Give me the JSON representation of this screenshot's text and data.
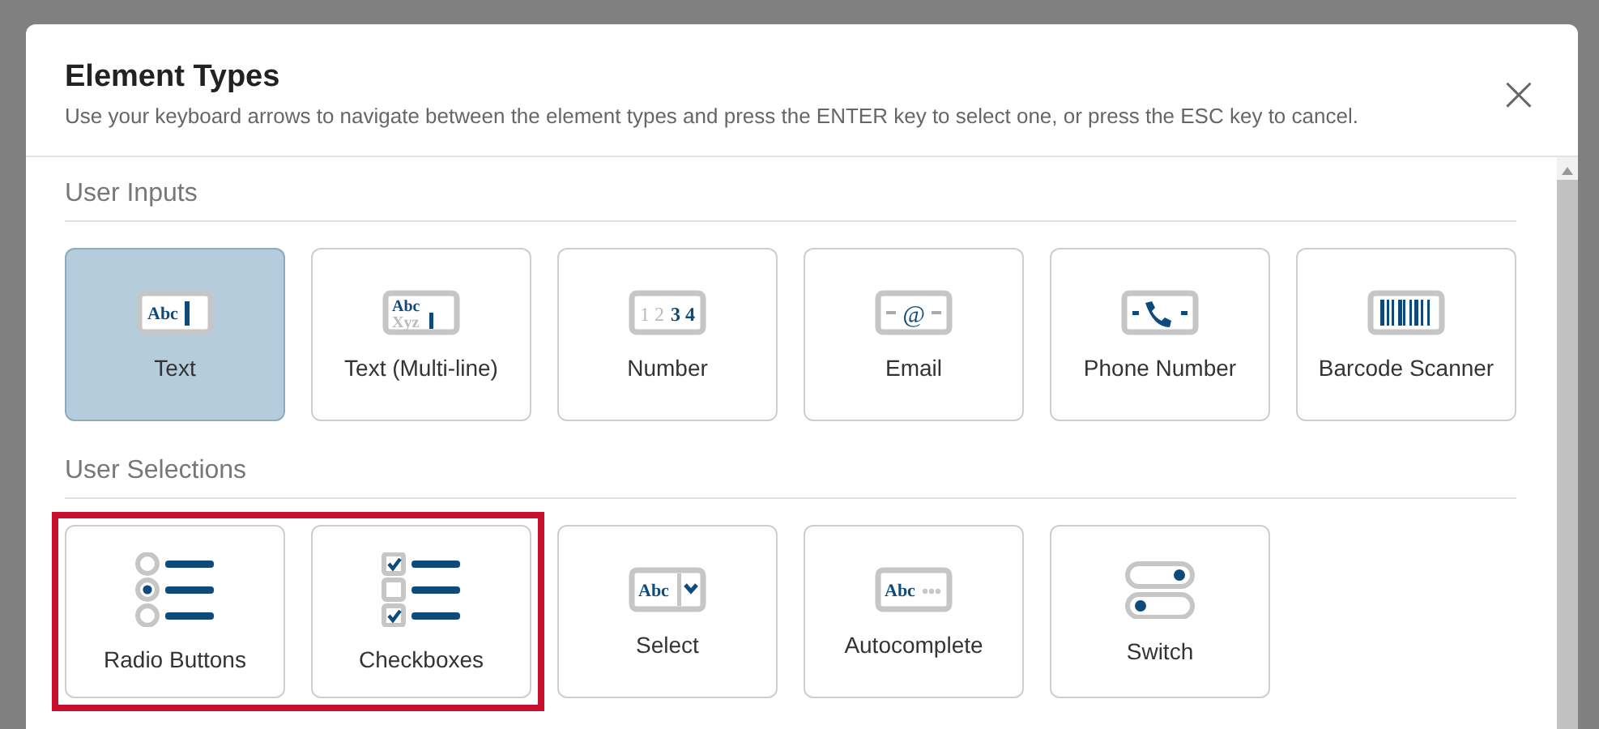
{
  "dialog": {
    "title": "Element Types",
    "subtitle": "Use your keyboard arrows to navigate between the element types and press the ENTER key to select one, or press the ESC key to cancel.",
    "close": "×"
  },
  "sections": [
    {
      "title": "User Inputs",
      "tiles": [
        {
          "label": "Text",
          "kind": "text",
          "icon_text": [
            "Abc"
          ],
          "selected": true,
          "highlighted": false
        },
        {
          "label": "Text (Multi-line)",
          "kind": "multiline",
          "icon_text": [
            "Abc",
            "Xyz"
          ],
          "selected": false,
          "highlighted": false
        },
        {
          "label": "Number",
          "kind": "number",
          "icon_text": [
            "1 2",
            "3 4"
          ],
          "selected": false,
          "highlighted": false
        },
        {
          "label": "Email",
          "kind": "email",
          "icon_text": [
            "@"
          ],
          "selected": false,
          "highlighted": false
        },
        {
          "label": "Phone Number",
          "kind": "phone",
          "selected": false,
          "highlighted": false
        },
        {
          "label": "Barcode Scanner",
          "kind": "barcode",
          "selected": false,
          "highlighted": false
        }
      ]
    },
    {
      "title": "User Selections",
      "tiles": [
        {
          "label": "Radio Buttons",
          "kind": "radio",
          "icon_states": [
            false,
            true,
            false
          ],
          "selected": false,
          "highlighted": true
        },
        {
          "label": "Checkboxes",
          "kind": "checkbox",
          "icon_states": [
            true,
            false,
            true
          ],
          "selected": false,
          "highlighted": true
        },
        {
          "label": "Select",
          "kind": "select",
          "icon_text": [
            "Abc"
          ],
          "selected": false,
          "highlighted": false
        },
        {
          "label": "Autocomplete",
          "kind": "autocomplete",
          "icon_text": [
            "Abc"
          ],
          "selected": false,
          "highlighted": false
        },
        {
          "label": "Switch",
          "kind": "switch",
          "icon_states": [
            true,
            false
          ],
          "selected": false,
          "highlighted": false
        }
      ]
    }
  ]
}
